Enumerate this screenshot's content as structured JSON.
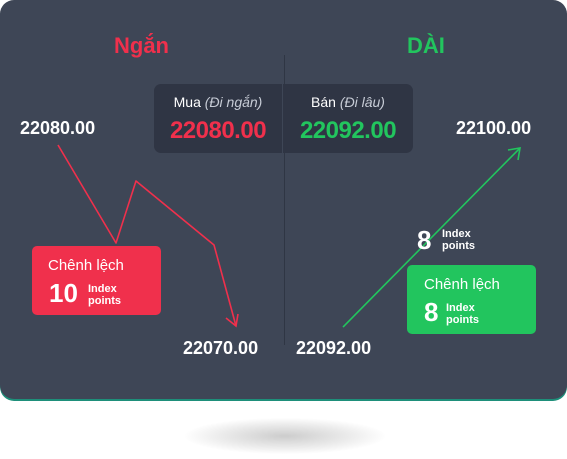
{
  "headers": {
    "short": "Ngắn",
    "long": "DÀI"
  },
  "quote": {
    "buy_label": "Mua",
    "buy_sub": "(Đi ngắn)",
    "buy_price": "22080.00",
    "sell_label": "Bán",
    "sell_sub": "(Đi lâu)",
    "sell_price": "22092.00"
  },
  "left": {
    "start_price": "22080.00",
    "end_price": "22070.00",
    "spread_title": "Chênh lệch",
    "spread_value": "10",
    "spread_unit_1": "Index",
    "spread_unit_2": "points"
  },
  "right": {
    "start_price": "22092.00",
    "end_price": "22100.00",
    "gain_value": "8",
    "gain_unit_1": "Index",
    "gain_unit_2": "points",
    "spread_title": "Chênh lệch",
    "spread_value": "8",
    "spread_unit_1": "Index",
    "spread_unit_2": "points"
  },
  "colors": {
    "short": "#f0304c",
    "long": "#22c55e",
    "card": "#3e4656",
    "panel": "#2f3544"
  }
}
